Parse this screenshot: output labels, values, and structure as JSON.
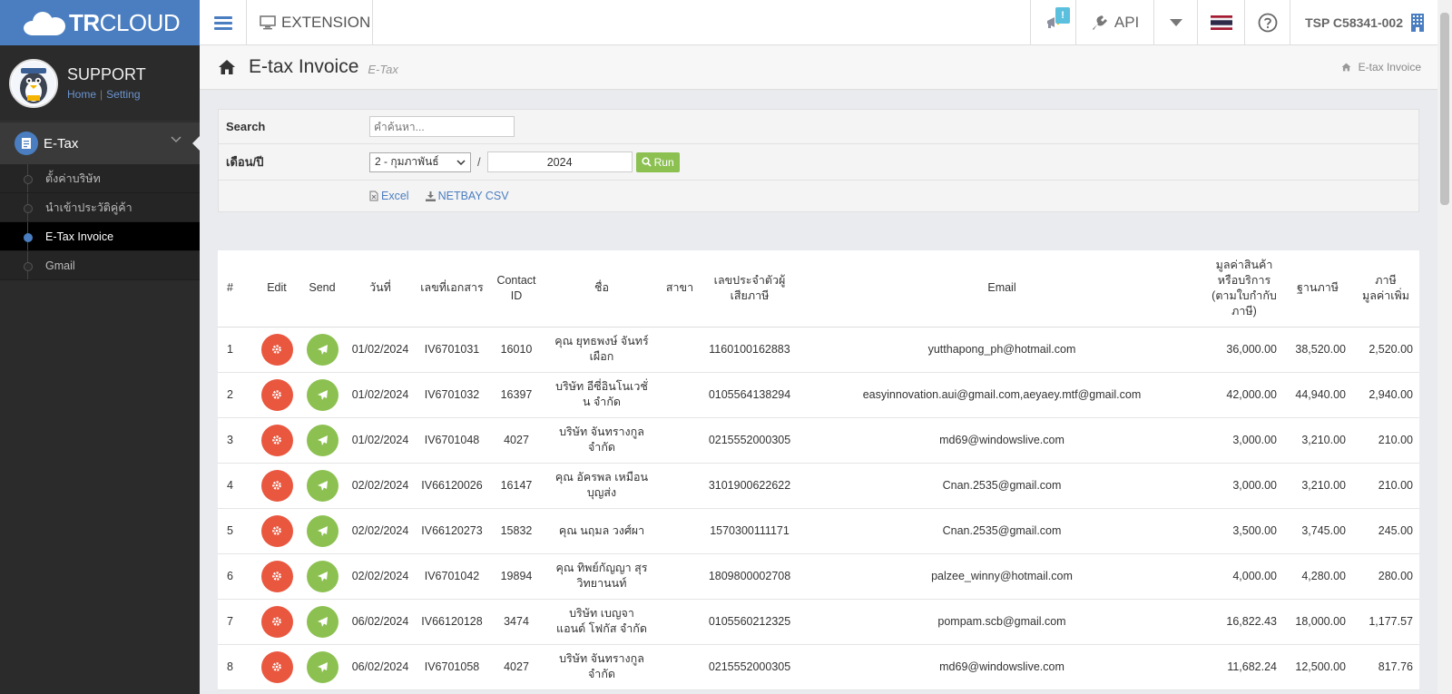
{
  "brand": {
    "logo_bold": "TR",
    "logo_rest": "CLOUD"
  },
  "topbar": {
    "extension_label": "EXTENSION",
    "notification_badge": "!",
    "api_label": "API",
    "user_label": "TSP C58341-002"
  },
  "sidebar": {
    "profile_name": "SUPPORT",
    "home_link": "Home",
    "setting_link": "Setting",
    "section_label": "E-Tax",
    "items": [
      {
        "label": "ตั้งค่าบริษัท"
      },
      {
        "label": "นำเข้าประวัติคู่ค้า"
      },
      {
        "label": "E-Tax Invoice"
      },
      {
        "label": "Gmail"
      }
    ]
  },
  "page": {
    "title": "E-tax Invoice",
    "subtitle": "E-Tax",
    "breadcrumb": "E-tax Invoice"
  },
  "filter": {
    "search_label": "Search",
    "search_placeholder": "คำค้นหา...",
    "period_label": "เดือน/ปี",
    "month_value": "2 - กุมภาพันธ์",
    "separator": "/",
    "year_value": "2024",
    "run_label": "Run",
    "excel_label": "Excel",
    "csv_label": "NETBAY CSV"
  },
  "table": {
    "headers": {
      "idx": "#",
      "edit": "Edit",
      "send": "Send",
      "date": "วันที่",
      "docno": "เลขที่เอกสาร",
      "contact": "Contact ID",
      "name": "ชื่อ",
      "branch": "สาขา",
      "taxid": "เลขประจำตัวผู้เสียภาษี",
      "email": "Email",
      "value": "มูลค่าสินค้าหรือบริการ (ตามใบกำกับภาษี)",
      "base": "ฐานภาษี",
      "vat": "ภาษีมูลค่าเพิ่ม"
    },
    "rows": [
      {
        "idx": "1",
        "date": "01/02/2024",
        "docno": "IV6701031",
        "contact": "16010",
        "name": "คุณ ยุทธพงษ์ จันทร์เผือก",
        "branch": "",
        "taxid": "1160100162883",
        "email": "yutthapong_ph@hotmail.com",
        "value": "36,000.00",
        "base": "38,520.00",
        "vat": "2,520.00"
      },
      {
        "idx": "2",
        "date": "01/02/2024",
        "docno": "IV6701032",
        "contact": "16397",
        "name": "บริษัท อีซี่อินโนเวชั่น จำกัด",
        "branch": "",
        "taxid": "0105564138294",
        "email": "easyinnovation.aui@gmail.com,aeyaey.mtf@gmail.com",
        "value": "42,000.00",
        "base": "44,940.00",
        "vat": "2,940.00"
      },
      {
        "idx": "3",
        "date": "01/02/2024",
        "docno": "IV6701048",
        "contact": "4027",
        "name": "บริษัท จันทรางกูล จำกัด",
        "branch": "",
        "taxid": "0215552000305",
        "email": "md69@windowslive.com",
        "value": "3,000.00",
        "base": "3,210.00",
        "vat": "210.00"
      },
      {
        "idx": "4",
        "date": "02/02/2024",
        "docno": "IV66120026",
        "contact": "16147",
        "name": "คุณ อัครพล เหมือนบุญส่ง",
        "branch": "",
        "taxid": "3101900622622",
        "email": "Cnan.2535@gmail.com",
        "value": "3,000.00",
        "base": "3,210.00",
        "vat": "210.00"
      },
      {
        "idx": "5",
        "date": "02/02/2024",
        "docno": "IV66120273",
        "contact": "15832",
        "name": "คุณ นฤมล วงศ์ผา",
        "branch": "",
        "taxid": "1570300111171",
        "email": "Cnan.2535@gmail.com",
        "value": "3,500.00",
        "base": "3,745.00",
        "vat": "245.00"
      },
      {
        "idx": "6",
        "date": "02/02/2024",
        "docno": "IV6701042",
        "contact": "19894",
        "name": "คุณ ทิพย์กัญญา สุรวิทยานนท์",
        "branch": "",
        "taxid": "1809800002708",
        "email": "palzee_winny@hotmail.com",
        "value": "4,000.00",
        "base": "4,280.00",
        "vat": "280.00"
      },
      {
        "idx": "7",
        "date": "06/02/2024",
        "docno": "IV66120128",
        "contact": "3474",
        "name": "บริษัท เบญจา แอนด์ โฟกัส จำกัด",
        "branch": "",
        "taxid": "0105560212325",
        "email": "pompam.scb@gmail.com",
        "value": "16,822.43",
        "base": "18,000.00",
        "vat": "1,177.57"
      },
      {
        "idx": "8",
        "date": "06/02/2024",
        "docno": "IV6701058",
        "contact": "4027",
        "name": "บริษัท จันทรางกูล จำกัด",
        "branch": "",
        "taxid": "0215552000305",
        "email": "md69@windowslive.com",
        "value": "11,682.24",
        "base": "12,500.00",
        "vat": "817.76"
      }
    ]
  },
  "colors": {
    "brand": "#4a7ec1",
    "edit": "#e9573f",
    "send": "#8cc152",
    "sidebar": "#2b2b2b"
  }
}
